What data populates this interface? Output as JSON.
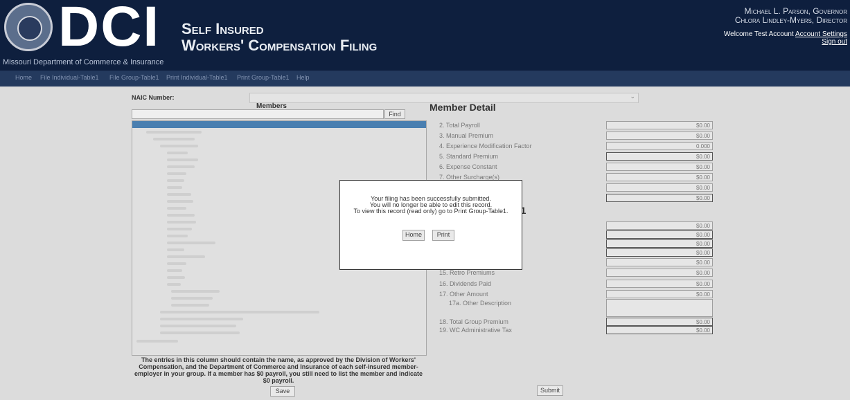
{
  "header": {
    "logo_text": "DCI",
    "department": "Missouri Department of Commerce & Insurance",
    "title_line1": "Self Insured",
    "title_line2": "Workers' Compensation Filing",
    "governor": "Michael L. Parson, Governor",
    "director": "Chlora Lindley-Myers, Director",
    "welcome": "Welcome Test Account",
    "account_settings": "Account Settings",
    "sign_out": "Sign out",
    "colors": {
      "background": "#0e1f3e",
      "nav": "#243a5e"
    }
  },
  "nav": {
    "items": [
      "Home",
      "File Individual-Table1",
      "File Group-Table1",
      "Print Individual-Table1",
      "Print Group-Table1",
      "Help"
    ]
  },
  "naic": {
    "label": "NAIC Number:"
  },
  "members": {
    "title": "Members",
    "find_label": "Find",
    "note": "The entries in this column should contain the name, as approved by the Division of Workers' Compensation, and the Department of Commerce and Insurance of each self-insured member-employer in your group. If a member has $0 payroll, you still need to list the member and indicate $0 payroll.",
    "save_label": "Save"
  },
  "detail": {
    "title": "Member Detail",
    "section_title": "e 1",
    "fields_top": [
      {
        "label": "2. Total Payroll",
        "value": "$0.00"
      },
      {
        "label": "3. Manual Premium",
        "value": "$0.00"
      },
      {
        "label": "4. Experience Modification Factor",
        "value": "0.000"
      },
      {
        "label": "5. Standard Premium",
        "value": "$0.00"
      },
      {
        "label": "6. Expense Constant",
        "value": "$0.00"
      },
      {
        "label": "7. Other Surcharge(s)",
        "value": "$0.00"
      },
      {
        "label": "",
        "value": "$0.00"
      },
      {
        "label": "",
        "value": "$0.00"
      }
    ],
    "fields_mid": [
      "$0.00",
      "$0.00",
      "$0.00",
      "$0.00",
      "$0.00"
    ],
    "fields_bottom": [
      {
        "label": "15. Retro Premiums",
        "value": "$0.00"
      },
      {
        "label": "16. Dividends Paid",
        "value": "$0.00"
      },
      {
        "label": "17. Other Amount",
        "value": "$0.00"
      }
    ],
    "other_description": "17a. Other Description",
    "total_group_premium": {
      "label": "18. Total Group Premium",
      "value": "$0.00"
    },
    "wc_admin_tax": {
      "label": "19. WC Administrative Tax",
      "value": "$0.00"
    },
    "submit_label": "Submit"
  },
  "modal": {
    "line1": "Your filing has been successfully submitted.",
    "line2": "You will no longer be able to edit this record.",
    "line3": "To view this record (read only) go to Print Group-Table1.",
    "home_label": "Home",
    "print_label": "Print"
  }
}
